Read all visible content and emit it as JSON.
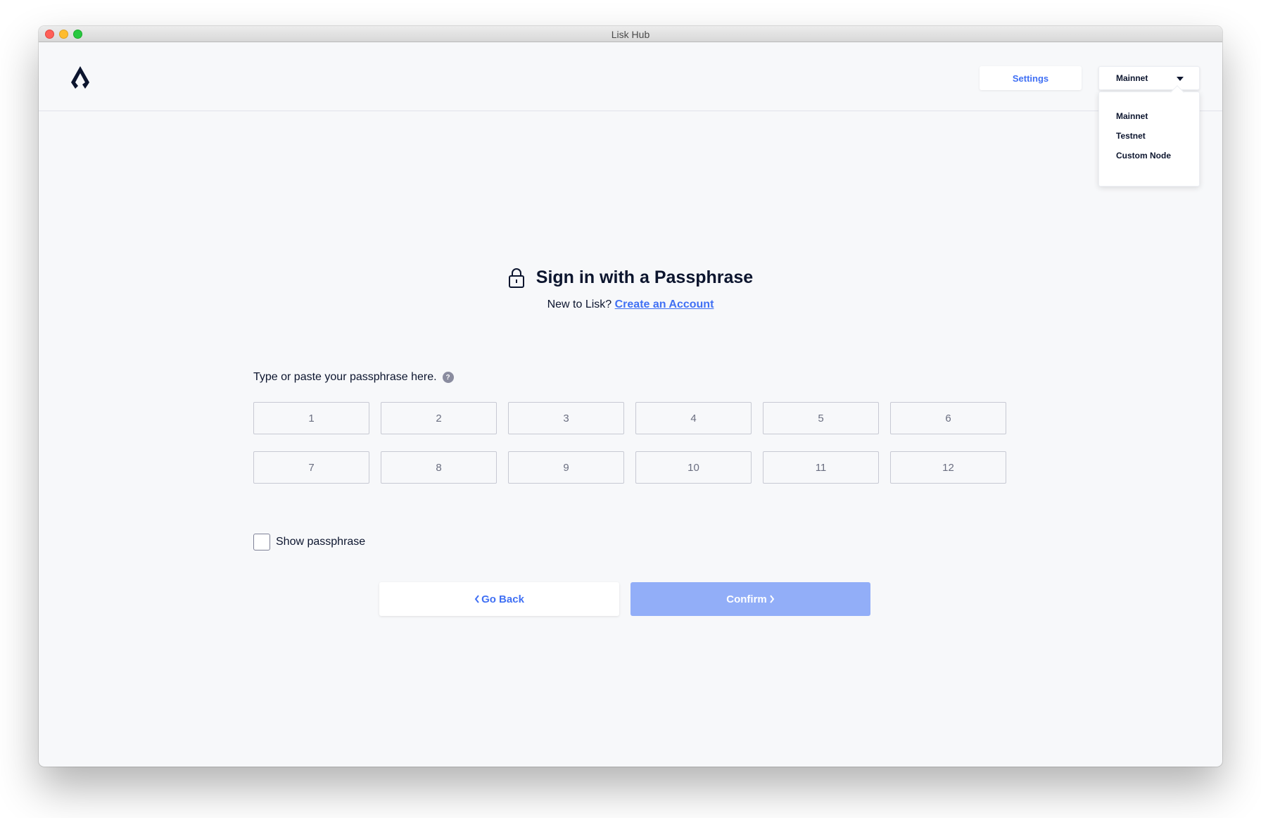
{
  "window": {
    "title": "Lisk Hub"
  },
  "header": {
    "logo_icon": "lisk-logo-icon",
    "settings_label": "Settings",
    "network": {
      "selected": "Mainnet",
      "options": [
        "Mainnet",
        "Testnet",
        "Custom Node"
      ]
    }
  },
  "main": {
    "title": "Sign in with a Passphrase",
    "title_icon": "lock-icon",
    "subtitle_prefix": "New to Lisk?",
    "create_account_link": "Create an Account",
    "passphrase_hint": "Type or paste your passphrase here.",
    "help_icon_glyph": "?",
    "word_placeholders": [
      "1",
      "2",
      "3",
      "4",
      "5",
      "6",
      "7",
      "8",
      "9",
      "10",
      "11",
      "12"
    ],
    "show_passphrase_label": "Show passphrase",
    "back_label": "Go Back",
    "confirm_label": "Confirm"
  },
  "colors": {
    "accent": "#4070f4",
    "confirm_disabled": "#92aef8",
    "text_dark": "#0c152e",
    "background": "#f7f8fa"
  }
}
